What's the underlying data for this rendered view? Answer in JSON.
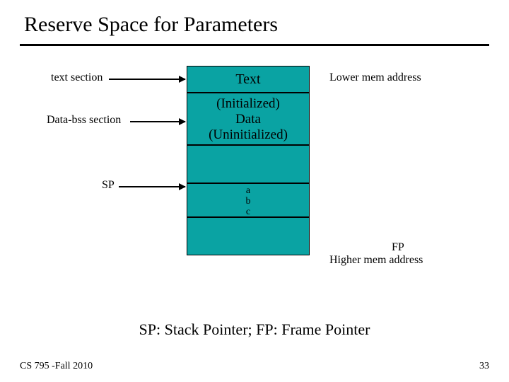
{
  "title": "Reserve Space for Parameters",
  "labels": {
    "text_section": "text section",
    "data_bss_section": "Data-bss section",
    "sp": "SP",
    "lower_mem": "Lower mem address",
    "fp": "FP",
    "higher_mem": "Higher mem address"
  },
  "segments": {
    "text": "Text",
    "data_line1": "(Initialized)",
    "data_line2": "Data",
    "data_line3": "(Uninitialized)",
    "param_a": "a",
    "param_b": "b",
    "param_c": "c"
  },
  "caption": "SP: Stack Pointer; FP: Frame Pointer",
  "footer": {
    "left": "CS 795 -Fall 2010",
    "page": "33"
  }
}
